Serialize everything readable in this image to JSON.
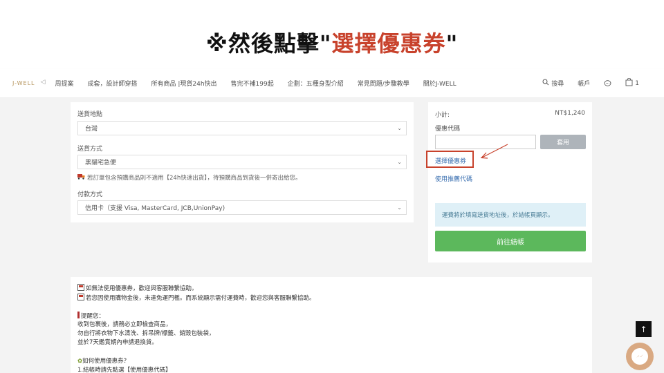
{
  "headline": {
    "prefix": "※然後點擊\"",
    "accent": "選擇優惠券",
    "suffix": "\""
  },
  "navbar": {
    "logo": "J-WELL",
    "back_arrow": "◁",
    "items": [
      "周提案",
      "成套，設計師穿搭",
      "所有商品 |現貨24h快出",
      "售完不補199起",
      "企劃：五種身型介紹",
      "常見問題/步驟教學",
      "關於J-WELL"
    ],
    "search_label": "搜尋",
    "account_label": "帳戶",
    "cart_count": "1"
  },
  "form": {
    "destination_label": "送貨地點",
    "destination_value": "台灣",
    "shipping_label": "送貨方式",
    "shipping_value": "黑貓宅急便",
    "shipping_note": "若訂單包含預購商品則不適用【24h快速出貨】，待預購商品到貨後一併寄出給您。",
    "payment_label": "付款方式",
    "payment_value": "信用卡（支援 Visa, MasterCard, JCB,UnionPay)"
  },
  "summary": {
    "subtotal_label": "小計:",
    "subtotal_value": "NT$1,240",
    "coupon_code_label": "優惠代碼",
    "apply_label": "套用",
    "select_coupon_label": "選擇優惠券",
    "referral_label": "使用推薦代碼",
    "shipping_info": "運費將於填寫送貨地址後，於結帳頁顯示。",
    "checkout_label": "前往結帳"
  },
  "notes": {
    "line1": "如無法使用優惠券，歡迎與客服聯繫協助。",
    "line2": "若您因使用購物金後，未達免運門檻。而系統顯示需付運費時，歡迎您與客服聯繫協助。",
    "reminder_title": "提醒您：",
    "reminder1": "收到包裹後，請務必立即檢查商品，",
    "reminder2": "勿自行將衣物下水清洗、拆吊牌/標籤、銷毀包裝袋，",
    "reminder3": "並於7天鑑賞期內申請退換貨。",
    "howto_title": "如何使用優惠券？",
    "howto1": "1.結帳時請先點選【使用優惠代碼】"
  },
  "colors": {
    "accent_red": "#c8422c",
    "link_blue": "#3a6fb0",
    "checkout_green": "#5cb85c"
  },
  "icons": {
    "search": "search-icon",
    "chat": "chat-icon",
    "cart": "shopping-bag-icon",
    "scroll_top": "arrow-up-icon",
    "messenger": "messenger-icon"
  }
}
